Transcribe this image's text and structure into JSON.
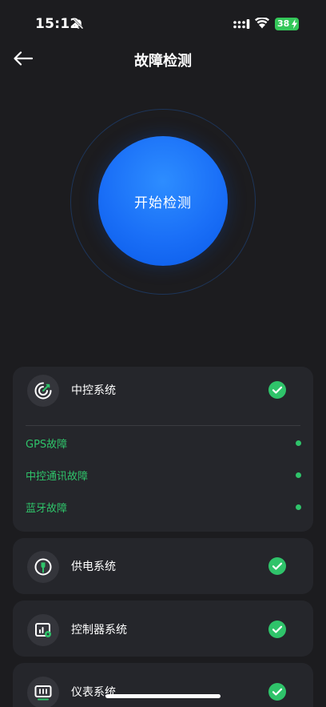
{
  "status_bar": {
    "time": "15:12",
    "battery": "38"
  },
  "header": {
    "title": "故障检测"
  },
  "detection": {
    "button_label": "开始检测"
  },
  "systems": [
    {
      "name": "中控系统",
      "icon": "radar-target-icon",
      "status": "ok",
      "faults": [
        "GPS故障",
        "中控通讯故障",
        "蓝牙故障"
      ]
    },
    {
      "name": "供电系统",
      "icon": "power-plug-icon",
      "status": "ok"
    },
    {
      "name": "控制器系统",
      "icon": "controller-chart-icon",
      "status": "ok"
    },
    {
      "name": "仪表系统",
      "icon": "dashboard-display-icon",
      "status": "ok"
    }
  ],
  "colors": {
    "accent_blue": "#1a6ff7",
    "ok_green": "#2fc36a",
    "background": "#1c1c1f",
    "card": "#25262b"
  }
}
